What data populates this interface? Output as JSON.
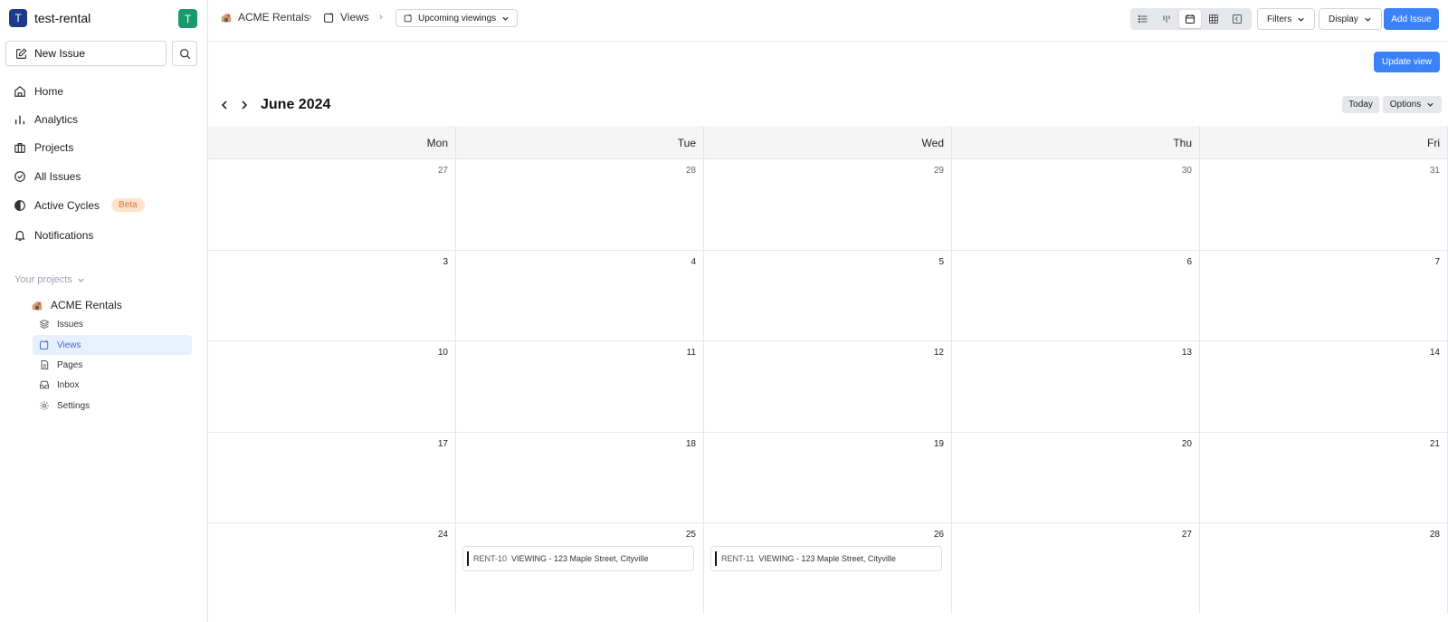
{
  "workspace": {
    "logo_letter": "T",
    "name": "test-rental",
    "avatar_letter": "T"
  },
  "sidebar": {
    "new_issue": "New Issue",
    "nav": [
      {
        "label": "Home"
      },
      {
        "label": "Analytics"
      },
      {
        "label": "Projects"
      },
      {
        "label": "All Issues"
      },
      {
        "label": "Active Cycles",
        "badge": "Beta"
      },
      {
        "label": "Notifications"
      }
    ],
    "your_projects": "Your projects",
    "project": {
      "name": "ACME Rentals"
    },
    "sub": [
      {
        "label": "Issues"
      },
      {
        "label": "Views",
        "active": true
      },
      {
        "label": "Pages"
      },
      {
        "label": "Inbox"
      },
      {
        "label": "Settings"
      }
    ]
  },
  "header": {
    "crumb_project": "ACME Rentals",
    "crumb_views": "Views",
    "view_name": "Upcoming viewings",
    "filters": "Filters",
    "display": "Display",
    "add_issue": "Add Issue",
    "active_layout": "calendar"
  },
  "update_view": "Update view",
  "calendar": {
    "title": "June 2024",
    "today": "Today",
    "options": "Options",
    "days": [
      "Mon",
      "Tue",
      "Wed",
      "Thu",
      "Fri"
    ],
    "weeks": [
      [
        "27",
        "28",
        "29",
        "30",
        "31"
      ],
      [
        "3",
        "4",
        "5",
        "6",
        "7"
      ],
      [
        "10",
        "11",
        "12",
        "13",
        "14"
      ],
      [
        "17",
        "18",
        "19",
        "20",
        "21"
      ],
      [
        "24",
        "25",
        "26",
        "27",
        "28"
      ]
    ],
    "events": [
      {
        "id": "RENT-10",
        "title": "VIEWING - 123 Maple Street, Cityville"
      },
      {
        "id": "RENT-11",
        "title": "VIEWING - 123 Maple Street, Cityville"
      }
    ]
  },
  "colors": {
    "accent": "#3b82f6",
    "workspace": "#1e3a8a",
    "avatar": "#1a9a6b",
    "beta_bg": "#fde3cc",
    "beta_text": "#d9733a"
  }
}
